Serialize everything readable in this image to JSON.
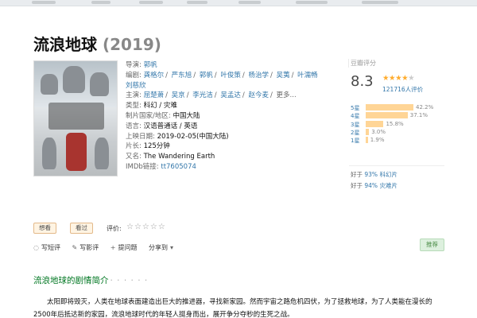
{
  "movie": {
    "title": "流浪地球",
    "year": "(2019)"
  },
  "info": {
    "director_label": "导演:",
    "director": "郭帆",
    "writers_label": "编剧:",
    "writers": [
      "龚格尔",
      "严东旭",
      "郭帆",
      "叶俊策",
      "杨治学",
      "吴荑",
      "叶濡畅",
      "刘慈欣"
    ],
    "cast_label": "主演:",
    "cast": [
      "屈楚萧",
      "吴京",
      "李光洁",
      "吴孟达",
      "赵今麦"
    ],
    "cast_more": "更多...",
    "genre_label": "类型:",
    "genre": "科幻 / 灾难",
    "country_label": "制片国家/地区:",
    "country": "中国大陆",
    "language_label": "语言:",
    "language": "汉语普通话 / 英语",
    "release_label": "上映日期:",
    "release": "2019-02-05(中国大陆)",
    "runtime_label": "片长:",
    "runtime": "125分钟",
    "aka_label": "又名:",
    "aka": "The Wandering Earth",
    "imdb_label": "IMDb链接:",
    "imdb": "tt7605074"
  },
  "rating": {
    "header": "豆瓣评分",
    "score": "8.3",
    "stars": 4,
    "votes": "121716人评价",
    "distribution": [
      {
        "label": "5星",
        "percent": 42.2,
        "text": "42.2%"
      },
      {
        "label": "4星",
        "percent": 37.1,
        "text": "37.1%"
      },
      {
        "label": "3星",
        "percent": 15.8,
        "text": "15.8%"
      },
      {
        "label": "2星",
        "percent": 3.0,
        "text": "3.0%"
      },
      {
        "label": "1星",
        "percent": 1.9,
        "text": "1.9%"
      }
    ],
    "better_than": [
      {
        "prefix": "好于",
        "pct": "93%",
        "genre": "科幻片"
      },
      {
        "prefix": "好于",
        "pct": "94%",
        "genre": "灾难片"
      }
    ]
  },
  "actions": {
    "want": "想看",
    "seen": "看过",
    "rate_label": "评价:",
    "rate_stars": "☆☆☆☆☆"
  },
  "links": {
    "short_review": "写短评",
    "review": "写影评",
    "question": "提问题",
    "share": "分享到",
    "recommend": "推荐"
  },
  "summary": {
    "title": "流浪地球的剧情简介",
    "dots": "· · · · · ·",
    "text": "太阳即将毁灭，人类在地球表面建造出巨大的推进器，寻找新家园。然而宇宙之路危机四伏，为了拯救地球，为了人类能在漫长的2500年后抵达新的家园，流浪地球时代的年轻人挺身而出，展开争分夺秒的生死之战。"
  },
  "colors": {
    "link": "#3377aa",
    "star": "#ffac2d",
    "bar": "#ffd596",
    "section": "#007722"
  }
}
